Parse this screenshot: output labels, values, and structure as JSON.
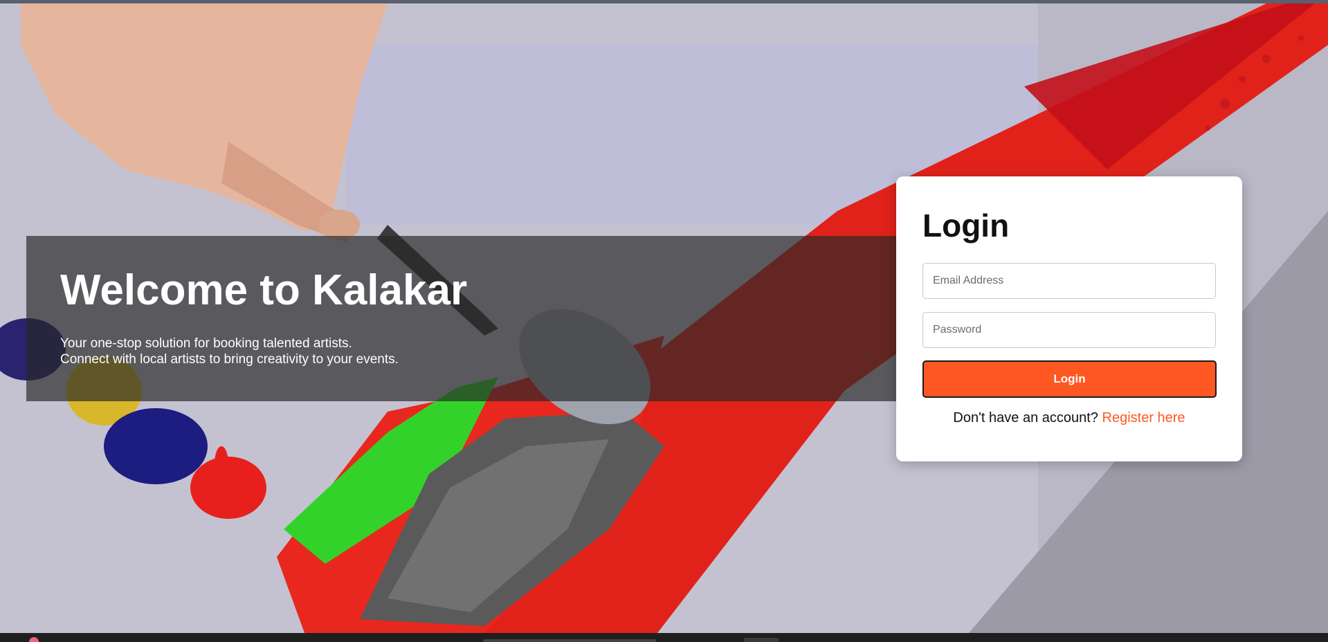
{
  "hero": {
    "title": "Welcome to Kalakar",
    "subtitle_line1": "Your one-stop solution for booking talented artists.",
    "subtitle_line2": "Connect with local artists to bring creativity to your events."
  },
  "login": {
    "title": "Login",
    "email_placeholder": "Email Address",
    "password_placeholder": "Password",
    "button_label": "Login",
    "register_prompt": "Don't have an account?",
    "register_link": "Register here"
  },
  "colors": {
    "accent": "#ff5722",
    "overlay": "#282828",
    "card": "#ffffff"
  }
}
